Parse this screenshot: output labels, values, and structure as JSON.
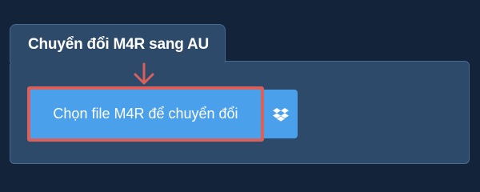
{
  "converter": {
    "tab_title": "Chuyển đổi M4R sang AU",
    "upload_button_label": "Chọn file M4R để chuyển đổi"
  },
  "icons": {
    "arrow": "arrow-down-icon",
    "dropbox": "dropbox-icon"
  },
  "colors": {
    "background": "#13233a",
    "panel": "#2d4a6b",
    "button": "#4aa0ea",
    "highlight": "#d9605b"
  }
}
